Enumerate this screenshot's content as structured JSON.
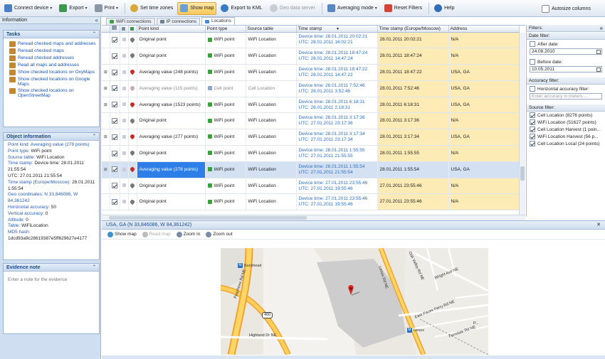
{
  "toolbar": {
    "connect_device": "Connect device",
    "export": "Export",
    "print": "Print",
    "set_time_zones": "Set time zones",
    "show_map": "Show map",
    "export_kml": "Export to KML",
    "geo_data_server": "Geo data server",
    "averaging_mode": "Averaging mode",
    "reset_filters": "Reset Filters",
    "help": "Help",
    "autosize_columns": "Autosize columns"
  },
  "left": {
    "title": "Information",
    "collapse_glyph": "«",
    "tasks_title": "Tasks",
    "collapse_icon": "⌃",
    "tasks": [
      "Reread checked maps and addresses",
      "Reread checked maps",
      "Reread checked addresses",
      "Read all maps and addresses",
      "Show checked locations on OxyMaps",
      "Show checked locations on Google Maps",
      "Show checked locations on OpenStreetMap"
    ],
    "object_info_title": "Object information",
    "object_info": [
      {
        "k": "Point kind: Averaging  value (278 points)",
        "v": ""
      },
      {
        "k": "Point type: ",
        "v": "WiFi point"
      },
      {
        "k": "Source table: ",
        "v": "WiFi Location"
      },
      {
        "k": "Time stamp: ",
        "v": "Device time: 28.01.2011"
      },
      {
        "k": "",
        "v": "21:55:54"
      },
      {
        "k": "",
        "v": "UTC: 27.01.2011 21:55:54"
      },
      {
        "k": "Time stamp (Europe/Moscow): ",
        "v": "28.01.2011"
      },
      {
        "k": "",
        "v": "1:55:54"
      },
      {
        "k": "Geo coordinates: N 33,846086, W",
        "v": ""
      },
      {
        "k": "84,361242",
        "v": ""
      },
      {
        "k": "Horizontal accuracy: ",
        "v": "50"
      },
      {
        "k": "Vertical accuracy: ",
        "v": "0"
      },
      {
        "k": "Altitude: ",
        "v": "0"
      },
      {
        "k": "Table: ",
        "v": "WiFiLocation"
      },
      {
        "k": "MD5 hash:",
        "v": ""
      },
      {
        "k": "",
        "v": "1dcd93a9c28619387e5ff629627e4177"
      }
    ],
    "evidence_title": "Evidence note",
    "evidence_placeholder": "Enter a note for the evidence"
  },
  "tabs": [
    "WiFi connections",
    "IP connections",
    "Locations"
  ],
  "grid": {
    "columns": [
      "Point kind",
      "Point type",
      "Source table",
      "Time stamp",
      "Time stamp (Europe/Moscow)",
      "Address"
    ],
    "sort_glyph": "▼",
    "rows": [
      {
        "exp": "",
        "kind": "Original point",
        "type": "WiFi point",
        "src": "WiFi Location",
        "dev": "Device time: 28.01.2011 20:02:21",
        "utc": "UTC: 28.01.2011 16:02:21",
        "msk": "28.01.2011 20:02:21",
        "addr": "N/A",
        "pin": "#777"
      },
      {
        "exp": "",
        "kind": "Original point",
        "type": "WiFi point",
        "src": "WiFi Location",
        "dev": "Device time: 28.01.2011 18:47:24",
        "utc": "UTC: 28.01.2011 14:47:24",
        "msk": "28.01.2011 18:47:24",
        "addr": "N/A",
        "pin": "#777"
      },
      {
        "exp": "⊞",
        "kind": "Averaging  value (248 points)",
        "type": "WiFi point",
        "src": "WiFi Location",
        "dev": "Device time: 28.01.2011 18:47:22",
        "utc": "UTC: 28.01.2011 14:47:22",
        "msk": "28.01.2011 18:47:22",
        "addr": "USA, GA",
        "pin": "#c62a25"
      },
      {
        "exp": "⊞",
        "kind": "Averaging  value (115 points)",
        "type": "Cell point",
        "src": "Cell Location",
        "dev": "Device time: 28.01.2011 7:52:46",
        "utc": "UTC: 28.01.2011 3:52:46",
        "msk": "28.01.2011 7:52:46",
        "addr": "USA, GA",
        "pin": "#c9a9a9",
        "dim": true
      },
      {
        "exp": "⊞",
        "kind": "Averaging  value (1523 points)",
        "type": "WiFi point",
        "src": "WiFi Location",
        "dev": "Device time: 28.01.2011 6:18:31",
        "utc": "UTC: 28.01.2011 2:18:31",
        "msk": "28.01.2011 6:18:31",
        "addr": "USA, GA",
        "pin": "#c62a25"
      },
      {
        "exp": "",
        "kind": "Original point",
        "type": "WiFi point",
        "src": "WiFi Location",
        "dev": "Device time: 28.01.2011 3:17:36",
        "utc": "UTC: 27.01.2011 23:17:36",
        "msk": "28.01.2011 3:17:36",
        "addr": "N/A",
        "pin": "#777"
      },
      {
        "exp": "⊞",
        "kind": "Averaging  value (277 points)",
        "type": "WiFi point",
        "src": "WiFi Location",
        "dev": "Device time: 28.01.2011 3:17:34",
        "utc": "UTC: 27.01.2011 23:17:34",
        "msk": "28.01.2011 3:17:34",
        "addr": "USA, GA",
        "pin": "#c62a25"
      },
      {
        "exp": "",
        "kind": "Original point",
        "type": "WiFi point",
        "src": "WiFi Location",
        "dev": "Device time: 28.01.2011 1:55:55",
        "utc": "UTC: 27.01.2011 21:55:55",
        "msk": "28.01.2011 1:55:55",
        "addr": "N/A",
        "pin": "#777"
      },
      {
        "exp": "⊞",
        "kind": "Averaging  value (278 points)",
        "type": "WiFi point",
        "src": "WiFi Location",
        "dev": "Device time: 28.01.2011 1:55:54",
        "utc": "UTC: 27.01.2011 21:55:54",
        "msk": "28.01.2011 1:55:54",
        "addr": "USA, GA",
        "pin": "#c62a25",
        "sel": true
      },
      {
        "exp": "",
        "kind": "Original point",
        "type": "WiFi point",
        "src": "WiFi Location",
        "dev": "Device time: 27.01.2011 23:55:46",
        "utc": "UTC: 27.01.2011 19:55:46",
        "msk": "27.01.2011 23:55:46",
        "addr": "N/A",
        "pin": "#777"
      },
      {
        "exp": "",
        "kind": "Original point",
        "type": "WiFi point",
        "src": "WiFi Location",
        "dev": "Device time: 27.01.2011 23:55:46",
        "utc": "UTC: 27.01.2011 19:55:46",
        "msk": "27.01.2011 23:55:46",
        "addr": "N/A",
        "pin": "#777"
      }
    ]
  },
  "filters": {
    "title": "Filters:",
    "expand_glyph": "»",
    "date_filter": "Date filter:",
    "after_date": "After date:",
    "after_value": "24.08.2010",
    "before_date": "Before date:",
    "before_value": "10.05.2011",
    "accuracy_filter": "Accuracy filter:",
    "horizontal_accuracy": "Horizontal accuracy filter:",
    "accuracy_placeholder": "Enter accuracy in meters ...",
    "source_filter": "Source filter:",
    "sources": [
      "Cell Location (8276 points)",
      "WiFi Location (51627 points)",
      "Cell Location Harvest (1 poin...",
      "WiFi Location Harvest (56 p...",
      "Cell Location Local (24 points)"
    ]
  },
  "mapsection": {
    "title": "USA, GA (N 33,846086, W 84,361242)",
    "close_glyph": "✕",
    "show_map": "Show map",
    "read_map": "Read map",
    "zoom_in": "Zoom in",
    "zoom_out": "Zoom out",
    "labels": {
      "buckhead": "Buckhead",
      "lenox_rd": "Lenox Rd NE",
      "peachtree_rd": "Peachtree Rd NE",
      "oak_valley": "Oak Valley Rd NE",
      "wright_ave": "Wright Ave NE",
      "east_paces": "East Paces Ferry Rd NE",
      "highland": "Highland Dr NE",
      "ferndale": "Ferndale Rd NE",
      "lenox": "Lenox",
      "route": "400",
      "badge_letter": "M",
      "paces_short": "P..."
    }
  }
}
